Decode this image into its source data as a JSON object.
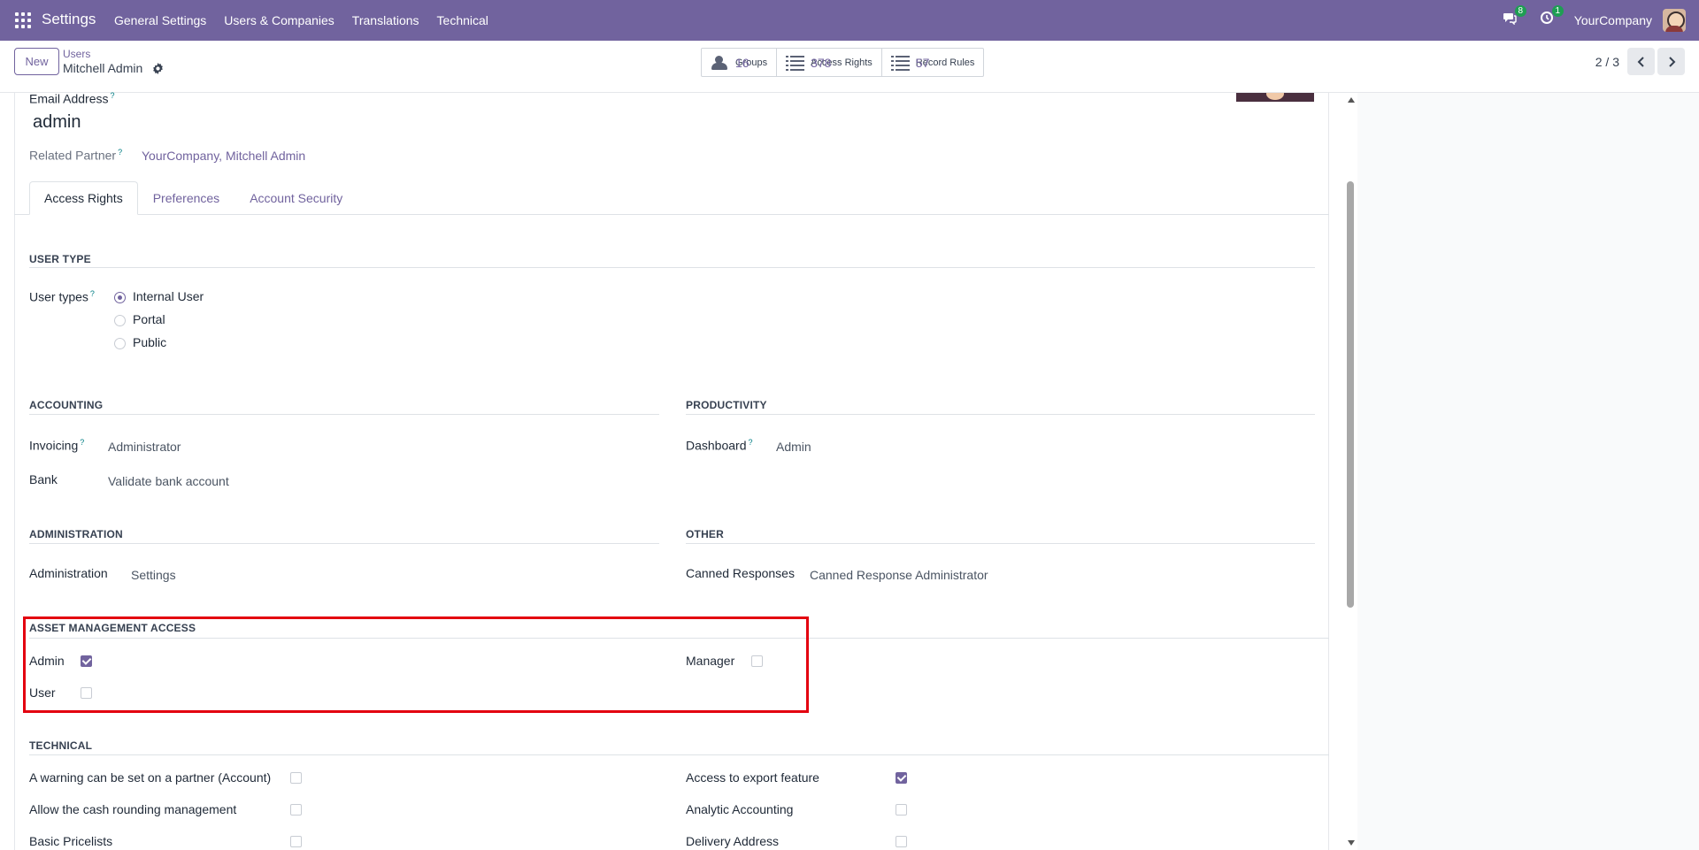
{
  "navbar": {
    "brand": "Settings",
    "menu": [
      "General Settings",
      "Users & Companies",
      "Translations",
      "Technical"
    ],
    "messages_count": "8",
    "activity_count": "1",
    "company": "YourCompany"
  },
  "control": {
    "new_label": "New",
    "breadcrumb_parent": "Users",
    "breadcrumb_current": "Mitchell Admin",
    "smart_buttons": [
      {
        "label": "Groups",
        "value": "16",
        "icon": "users-icon"
      },
      {
        "label": "Access Rights",
        "value": "378",
        "icon": "list-icon"
      },
      {
        "label": "Record Rules",
        "value": "57",
        "icon": "list-icon"
      }
    ],
    "pager": "2 / 3"
  },
  "form": {
    "email_label": "Email Address",
    "email_value": "admin",
    "partner_label": "Related Partner",
    "partner_value": "YourCompany, Mitchell Admin",
    "help_mark": "?"
  },
  "tabs": [
    "Access Rights",
    "Preferences",
    "Account Security"
  ],
  "user_type": {
    "title": "USER TYPE",
    "label": "User types",
    "options": [
      "Internal User",
      "Portal",
      "Public"
    ],
    "selected": "Internal User"
  },
  "accounting": {
    "title": "ACCOUNTING",
    "invoicing_label": "Invoicing",
    "invoicing_value": "Administrator",
    "bank_label": "Bank",
    "bank_value": "Validate bank account"
  },
  "productivity": {
    "title": "PRODUCTIVITY",
    "dashboard_label": "Dashboard",
    "dashboard_value": "Admin"
  },
  "administration": {
    "title": "ADMINISTRATION",
    "label": "Administration",
    "value": "Settings"
  },
  "other": {
    "title": "OTHER",
    "label": "Canned Responses",
    "value": "Canned Response Administrator"
  },
  "asset": {
    "title": "ASSET MANAGEMENT ACCESS",
    "admin_label": "Admin",
    "admin_checked": true,
    "user_label": "User",
    "user_checked": false,
    "manager_label": "Manager",
    "manager_checked": false
  },
  "technical": {
    "title": "TECHNICAL",
    "left": [
      {
        "label": "A warning can be set on a partner (Account)",
        "checked": false
      },
      {
        "label": "Allow the cash rounding management",
        "checked": false
      },
      {
        "label": "Basic Pricelists",
        "checked": false
      }
    ],
    "right": [
      {
        "label": "Access to export feature",
        "checked": true
      },
      {
        "label": "Analytic Accounting",
        "checked": false
      },
      {
        "label": "Delivery Address",
        "checked": false
      }
    ]
  },
  "colors": {
    "brand": "#71639e",
    "highlight": "#e3000f",
    "badge": "#1e9e53"
  }
}
